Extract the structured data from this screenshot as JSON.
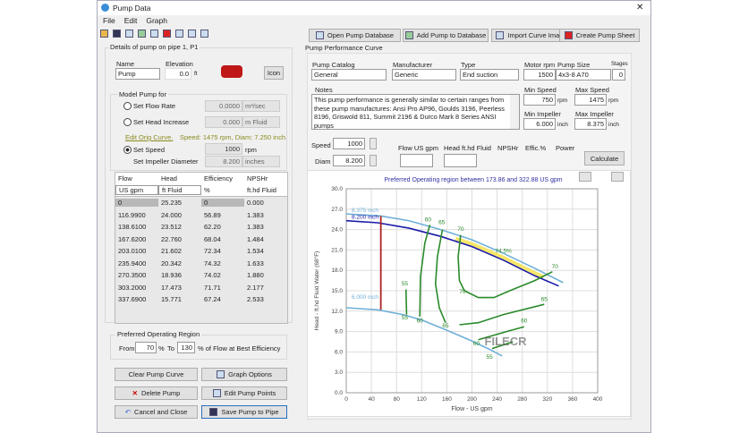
{
  "window": {
    "title": "Pump Data",
    "close": "✕"
  },
  "menu": [
    "File",
    "Edit",
    "Graph"
  ],
  "toolbar_icons": [
    "open-icon",
    "save-icon",
    "pump-db-icon",
    "add-pump-icon",
    "import-image-icon",
    "pump-sheet-icon",
    "graph-options-icon",
    "edit-points-icon",
    "curve-icon"
  ],
  "top_buttons": [
    "Open Pump Database",
    "Add Pump to Database",
    "Import Curve Image",
    "Create Pump Sheet"
  ],
  "details": {
    "group": "Details of pump on pipe 1, P1",
    "name_label": "Name",
    "name": "Pump",
    "elev_label": "Elevation",
    "elev": "0.0",
    "elev_unit": "ft",
    "icon_btn": "Icon"
  },
  "model": {
    "group": "Model Pump for",
    "flow_rate": "Set Flow Rate",
    "flow_val": "0.0000",
    "flow_unit": "m³/sec",
    "head": "Set Head Increase",
    "head_val": "0.000",
    "head_unit": "m Fluid",
    "edit_orig": "Edit Orig Curve.",
    "orig_info": "Speed: 1475 rpm, Diam: 7.250 inch",
    "speed": "Set Speed",
    "speed_val": "1000",
    "speed_unit": "rpm",
    "diam": "Set Impeller Diameter",
    "diam_val": "8.200",
    "diam_unit": "inches",
    "selected": "Set Speed"
  },
  "table": {
    "headers": [
      "Flow",
      "Head",
      "Efficiency",
      "NPSHr"
    ],
    "units": [
      "US gpm",
      "ft Fluid",
      "%",
      "ft.hd Fluid"
    ],
    "rows": [
      [
        "0",
        "25.235",
        "0",
        "0.000"
      ],
      [
        "116.9900",
        "24.000",
        "56.89",
        "1.383"
      ],
      [
        "138.6100",
        "23.512",
        "62.20",
        "1.383"
      ],
      [
        "167.6200",
        "22.760",
        "68.04",
        "1.484"
      ],
      [
        "203.0100",
        "21.602",
        "72.34",
        "1.534"
      ],
      [
        "235.9400",
        "20.342",
        "74.32",
        "1.633"
      ],
      [
        "270.3500",
        "18.936",
        "74.02",
        "1.880"
      ],
      [
        "303.2000",
        "17.473",
        "71.71",
        "2.177"
      ],
      [
        "337.6900",
        "15.771",
        "67.24",
        "2.533"
      ]
    ]
  },
  "por": {
    "group": "Preferred Operating Region",
    "from": "From",
    "from_val": "70",
    "pct": "%",
    "to": "To",
    "to_val": "130",
    "suffix": "% of Flow at Best Efficiency"
  },
  "bottom_buttons": [
    "Clear Pump Curve",
    "Graph Options",
    "Delete Pump",
    "Edit Pump Points",
    "Cancel and Close",
    "Save Pump to Pipe"
  ],
  "perf": {
    "group": "Pump Performance Curve",
    "catalog_label": "Pump Catalog",
    "catalog": "General",
    "mfr_label": "Manufacturer",
    "mfr": "Generic",
    "type_label": "Type",
    "type": "End suction",
    "rpm_label": "Motor rpm",
    "rpm": "1500",
    "size_label": "Pump Size",
    "size": "4x3-8 A70",
    "stages_label": "Stages",
    "stages": "0",
    "notes_label": "Notes",
    "notes": "This pump performance is generally similar to certain ranges from these pump manufactures: Ansi Pro AP96, Goulds 3196, Peerless 8196, Griswold 811, Summit 2196 & Durco Mark 8 Series ANSI pumps",
    "min_speed_label": "Min Speed",
    "min_speed": "750",
    "max_speed_label": "Max Speed",
    "max_speed": "1475",
    "rpm_unit": "rpm",
    "min_imp_label": "Min Impeller",
    "min_imp": "6.000",
    "max_imp_label": "Max Impeller",
    "max_imp": "8.375",
    "inch": "inch",
    "speed_label": "Speed",
    "speed": "1000",
    "diam_label": "Diam",
    "diam": "8.200",
    "flow_col": "Flow US gpm",
    "head_col": "Head ft.hd Fluid",
    "npshr_col": "NPSHr",
    "effic_col": "Effic.%",
    "power_col": "Power",
    "calculate": "Calculate"
  },
  "chart_data": {
    "type": "line",
    "title": "Preferred Operating region between 173.86 and 322.88 US gpm",
    "xlabel": "Flow - US gpm",
    "ylabel": "Head - ft.hd Fluid Water (68°F)",
    "xlim": [
      0,
      400
    ],
    "ylim": [
      0,
      30
    ],
    "xticks": [
      0,
      40,
      80,
      120,
      160,
      200,
      240,
      280,
      320,
      360,
      400
    ],
    "yticks": [
      "0.0",
      "3.0",
      "6.0",
      "9.0",
      "12.0",
      "15.0",
      "18.0",
      "21.0",
      "24.0",
      "27.0",
      "30.0"
    ],
    "grid": true,
    "series": [
      {
        "name": "8.375 inch",
        "color": "#6fb0d8",
        "points": [
          [
            0,
            26.3
          ],
          [
            55,
            26.0
          ],
          [
            100,
            25.3
          ],
          [
            150,
            24.0
          ],
          [
            200,
            22.5
          ],
          [
            250,
            20.5
          ],
          [
            300,
            18.3
          ],
          [
            345,
            16.2
          ]
        ]
      },
      {
        "name": "8.200 inch",
        "color": "#1a1aa8",
        "points": [
          [
            0,
            25.3
          ],
          [
            50,
            25.0
          ],
          [
            100,
            24.2
          ],
          [
            150,
            23.0
          ],
          [
            200,
            21.5
          ],
          [
            250,
            19.5
          ],
          [
            300,
            17.2
          ],
          [
            338,
            15.7
          ]
        ]
      },
      {
        "name": "6.000 inch",
        "color": "#6fb0d8",
        "points": [
          [
            0,
            12.5
          ],
          [
            50,
            12.2
          ],
          [
            90,
            11.5
          ],
          [
            120,
            10.7
          ],
          [
            160,
            9.2
          ],
          [
            200,
            7.6
          ],
          [
            230,
            6.3
          ],
          [
            248,
            5.4
          ]
        ]
      }
    ],
    "preferred_region": {
      "from": 173.86,
      "to": 322.88,
      "color": "#f5e66a"
    },
    "operating_line": {
      "flow": 55,
      "head_range": [
        12.2,
        26.0
      ],
      "color": "#b02020"
    },
    "efficiency_contours": [
      {
        "label": "55",
        "points": [
          [
            95,
            15.2
          ],
          [
            96,
            11.5
          ]
        ]
      },
      {
        "label": "60",
        "points": [
          [
            133,
            24.7
          ],
          [
            125,
            22
          ],
          [
            118,
            17
          ],
          [
            117,
            11.2
          ]
        ]
      },
      {
        "label": "65",
        "points": [
          [
            153,
            24
          ],
          [
            145,
            20
          ],
          [
            142,
            16
          ],
          [
            148,
            12.5
          ],
          [
            158,
            10.3
          ]
        ]
      },
      {
        "label": "70",
        "points": [
          [
            182,
            23.2
          ],
          [
            178,
            20
          ],
          [
            180,
            16.5
          ],
          [
            188,
            15
          ],
          [
            210,
            14
          ],
          [
            235,
            14
          ],
          [
            260,
            15
          ],
          [
            300,
            16.5
          ],
          [
            328,
            17.8
          ]
        ]
      },
      {
        "label": "65",
        "points": [
          [
            180,
            10
          ],
          [
            210,
            10.3
          ],
          [
            250,
            11.5
          ],
          [
            315,
            13
          ]
        ]
      },
      {
        "label": "60",
        "points": [
          [
            210,
            7.8
          ],
          [
            255,
            9
          ],
          [
            283,
            9.7
          ]
        ]
      },
      {
        "label": "55",
        "points": [
          [
            232,
            6.5
          ],
          [
            265,
            7.5
          ]
        ]
      }
    ],
    "annotations": [
      {
        "text": "74.5%",
        "x": 250,
        "y": 20.6
      },
      {
        "text": "60",
        "x": 130,
        "y": 25.2
      },
      {
        "text": "65",
        "x": 152,
        "y": 24.8
      },
      {
        "text": "70",
        "x": 182,
        "y": 23.8
      },
      {
        "text": "70",
        "x": 332,
        "y": 18.3
      },
      {
        "text": "55",
        "x": 93,
        "y": 15.8
      },
      {
        "text": "55",
        "x": 93,
        "y": 10.8
      },
      {
        "text": "60",
        "x": 117,
        "y": 10.3
      },
      {
        "text": "65",
        "x": 158,
        "y": 9.6
      },
      {
        "text": "70",
        "x": 185,
        "y": 14.6
      },
      {
        "text": "65",
        "x": 315,
        "y": 13.5
      },
      {
        "text": "60",
        "x": 283,
        "y": 10.3
      },
      {
        "text": "60",
        "x": 207,
        "y": 7.0
      },
      {
        "text": "55",
        "x": 228,
        "y": 5.0
      }
    ],
    "color_contour": "#2a8a2a"
  },
  "watermark": "FILECR .com"
}
